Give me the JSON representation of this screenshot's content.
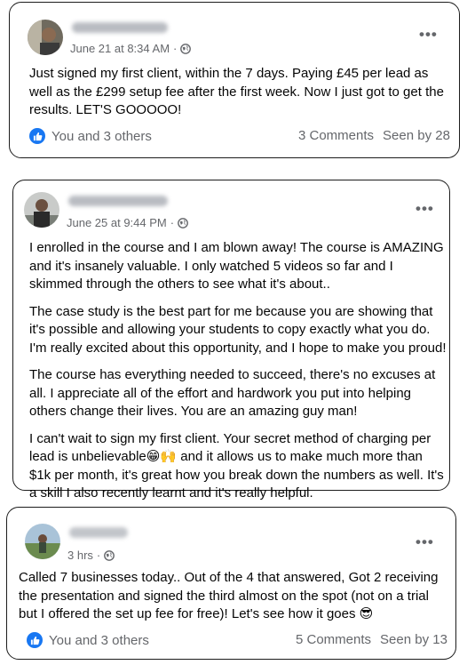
{
  "posts": [
    {
      "timestamp": "June 21 at 8:34 AM",
      "separator": "·",
      "paragraphs": [
        "Just signed my first client, within the 7 days. Paying £45 per lead as well as the £299 setup fee after the first week. Now I just got to get the results. LET'S GOOOOO!"
      ],
      "reactions_text": "You and 3 others",
      "comments": "3 Comments",
      "seen": "Seen by 28"
    },
    {
      "timestamp": "June 25 at 9:44 PM",
      "separator": "·",
      "paragraphs": [
        "I enrolled in the course and I am blown away! The course is AMAZING and it's insanely valuable. I only watched 5 videos so far and I skimmed through the others to see what it's about..",
        "The case study is the best part for me because you are showing that it's possible and allowing your students to copy exactly what you do. I'm really excited about this opportunity, and I hope to make you proud!",
        "The course has everything needed to succeed, there's no excuses at all. I appreciate all of the effort and hardwork you put into helping others change their lives. You are an amazing guy man!"
      ],
      "last_paragraph_before_emoji": "I can't wait to sign my first client. Your secret method of charging per lead is unbelievable",
      "last_paragraph_emoji": "😁🙌",
      "last_paragraph_after_emoji": " and it allows us to make much more than $1k per month, it's great how you break down the numbers as well. It's a skill I also recently learnt and it's really helpful."
    },
    {
      "timestamp": "3 hrs",
      "separator": "·",
      "text_before_emoji": "Called 7 businesses today.. Out of the 4 that answered, Got 2 receiving the presentation and signed the third almost on the spot (not on a trial but I offered the set up fee for free)! Let's see how it goes ",
      "emoji": "😎",
      "reactions_text": "You and 3 others",
      "comments": "5 Comments",
      "seen": "Seen by 13"
    }
  ],
  "icons": {
    "more": "more-options-icon",
    "privacy": "globe-icon",
    "like": "like-thumb-icon"
  },
  "colors": {
    "like_blue": "#1877f2",
    "meta_gray": "#65676b"
  }
}
